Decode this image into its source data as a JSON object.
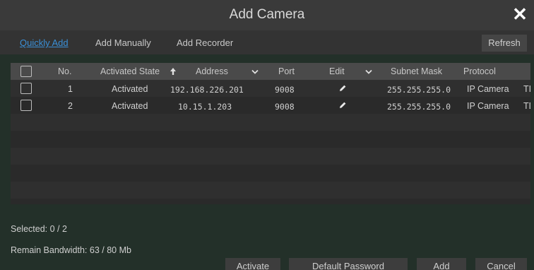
{
  "window": {
    "title": "Add Camera"
  },
  "tabs": [
    {
      "label": "Quickly Add",
      "active": true
    },
    {
      "label": "Add Manually",
      "active": false
    },
    {
      "label": "Add Recorder",
      "active": false
    }
  ],
  "toolbar": {
    "refresh_label": "Refresh"
  },
  "table": {
    "headers": {
      "no": "No.",
      "activated_state": "Activated State",
      "address": "Address",
      "port": "Port",
      "edit": "Edit",
      "subnet_mask": "Subnet Mask",
      "protocol": "Protocol"
    },
    "sort_icon": "arrow-up-icon",
    "rows": [
      {
        "no": "1",
        "state": "Activated",
        "address": "192.168.226.201",
        "port": "9008",
        "subnet": "255.255.255.0",
        "protocol": "IP Camera",
        "extra": "TI"
      },
      {
        "no": "2",
        "state": "Activated",
        "address": "10.15.1.203",
        "port": "9008",
        "subnet": "255.255.255.0",
        "protocol": "IP Camera",
        "extra": "TD"
      }
    ]
  },
  "status": {
    "selected": "Selected: 0 / 2",
    "bandwidth": "Remain Bandwidth: 63 / 80 Mb"
  },
  "actions": {
    "activate": "Activate",
    "default_password": "Default Password",
    "add": "Add",
    "cancel": "Cancel"
  },
  "colors": {
    "accent": "#3b8fd6",
    "panel": "#233029",
    "header": "#4a4a4a"
  }
}
